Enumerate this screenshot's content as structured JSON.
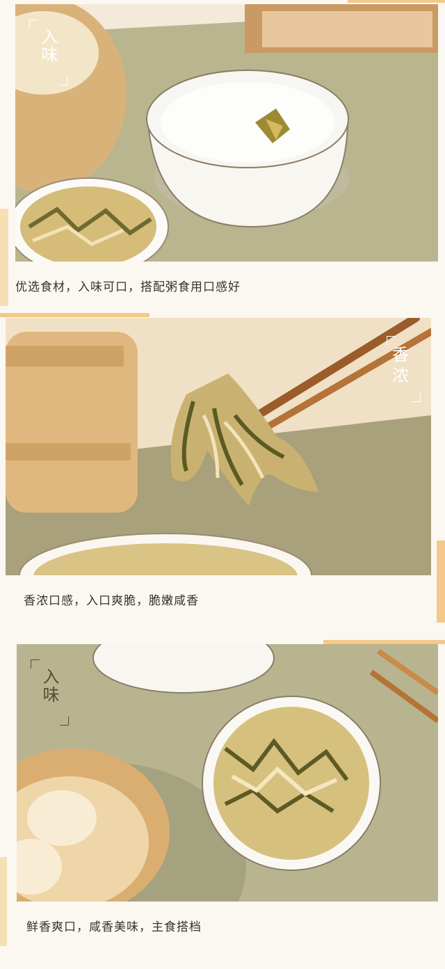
{
  "sections": [
    {
      "tag": "入味",
      "caption": "优选食材，入味可口，搭配粥食用口感好"
    },
    {
      "tag": "香浓",
      "caption": "香浓口感，入口爽脆，脆嫩咸香"
    },
    {
      "tag": "入味",
      "caption": "鲜香爽口，咸香美味，主食搭档"
    }
  ]
}
